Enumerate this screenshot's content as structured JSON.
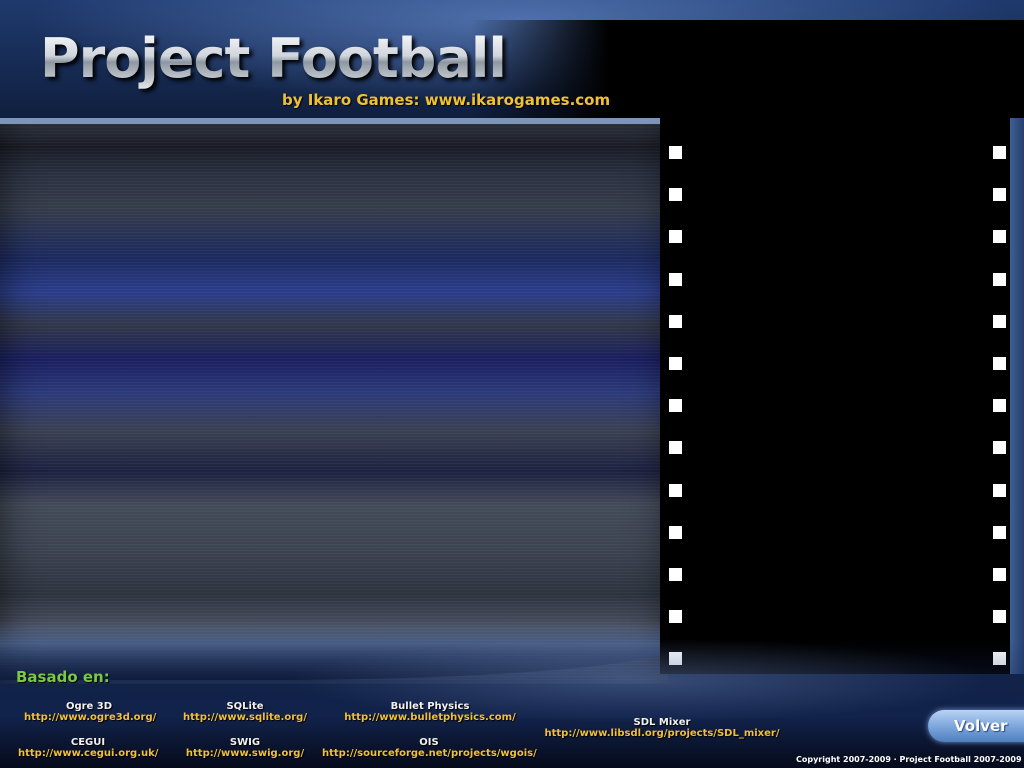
{
  "header": {
    "title": "Project Football",
    "subtitle": "by Ikaro Games: www.ikarogames.com"
  },
  "footer": {
    "based_label": "Basado en:",
    "credits": [
      {
        "name": "Ogre 3D",
        "url": "http://www.ogre3d.org/"
      },
      {
        "name": "SQLite",
        "url": "http://www.sqlite.org/"
      },
      {
        "name": "Bullet Physics",
        "url": "http://www.bulletphysics.com/"
      },
      {
        "name": "SDL Mixer",
        "url": "http://www.libsdl.org/projects/SDL_mixer/"
      },
      {
        "name": "CEGUI",
        "url": "http://www.cegui.org.uk/"
      },
      {
        "name": "SWIG",
        "url": "http://www.swig.org/"
      },
      {
        "name": "OIS",
        "url": "http://sourceforge.net/projects/wgois/"
      }
    ],
    "back_button": "Volver",
    "copyright": "Copyright 2007-2009  ·  Project Football 2007-2009"
  },
  "colors": {
    "accent_yellow": "#f0c036",
    "label_green": "#7ac943",
    "button_blue": "#7ea7dc"
  }
}
